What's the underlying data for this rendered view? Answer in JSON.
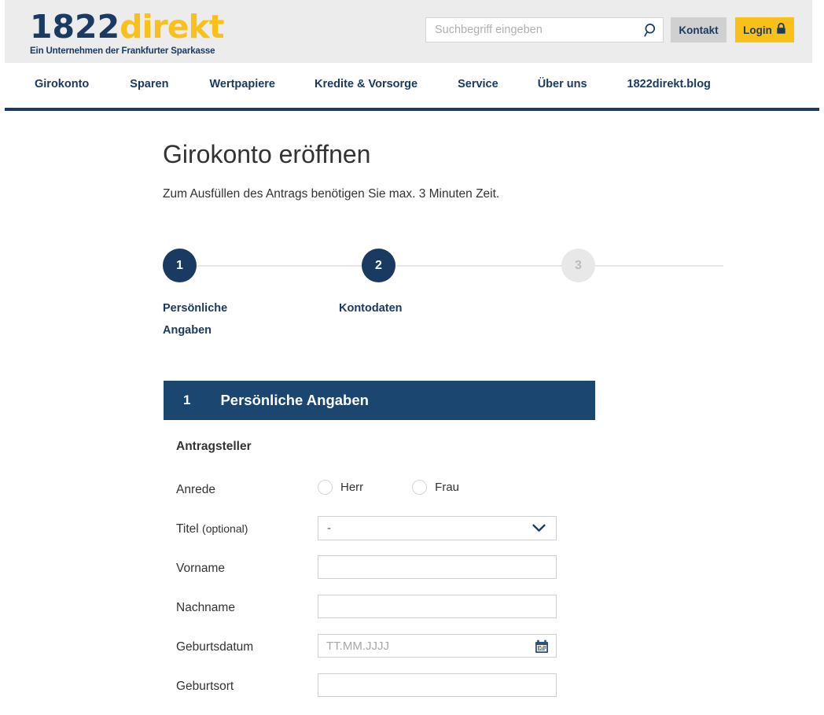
{
  "header": {
    "logo": {
      "number": "1822",
      "word": "direkt",
      "tagline": "Ein Unternehmen der Frankfurter Sparkasse"
    },
    "search": {
      "placeholder": "Suchbegriff eingeben",
      "value": "",
      "icon": "search-icon"
    },
    "kontakt_label": "Kontakt",
    "login_label": "Login",
    "login_icon": "lock-icon",
    "colors": {
      "band": "#ececec",
      "navy": "#1b3a62",
      "yellow": "#f9c01a",
      "kontakt_bg": "#d0d0d0"
    }
  },
  "nav": {
    "items": [
      {
        "label": "Girokonto"
      },
      {
        "label": "Sparen"
      },
      {
        "label": "Wertpapiere"
      },
      {
        "label": "Kredite & Vorsorge"
      },
      {
        "label": "Service"
      },
      {
        "label": "Über uns"
      },
      {
        "label": "1822direkt.blog"
      }
    ]
  },
  "main": {
    "title": "Girokonto eröffnen",
    "subtitle": "Zum Ausfüllen des Antrags benötigen Sie max. 3 Minuten Zeit."
  },
  "stepper": {
    "steps": [
      {
        "number": "1",
        "label": "Persönliche Angaben",
        "state": "active"
      },
      {
        "number": "2",
        "label": "Kontodaten",
        "state": "active"
      },
      {
        "number": "3",
        "label": "",
        "state": "inactive"
      }
    ]
  },
  "section": {
    "number": "1",
    "title": "Persönliche Angaben",
    "group_title": "Antragsteller",
    "fields": {
      "anrede": {
        "label": "Anrede",
        "options": [
          {
            "label": "Herr",
            "selected": false
          },
          {
            "label": "Frau",
            "selected": false
          }
        ]
      },
      "titel": {
        "label": "Titel",
        "label_optional": "(optional)",
        "value": "-",
        "chevron_icon": "chevron-down-icon"
      },
      "vorname": {
        "label": "Vorname",
        "value": "",
        "placeholder": ""
      },
      "nachname": {
        "label": "Nachname",
        "value": "",
        "placeholder": ""
      },
      "geburtsdatum": {
        "label": "Geburtsdatum",
        "value": "",
        "placeholder": "TT.MM.JJJJ",
        "icon": "calendar-icon"
      },
      "geburtsort": {
        "label": "Geburtsort",
        "value": "",
        "placeholder": ""
      }
    }
  }
}
